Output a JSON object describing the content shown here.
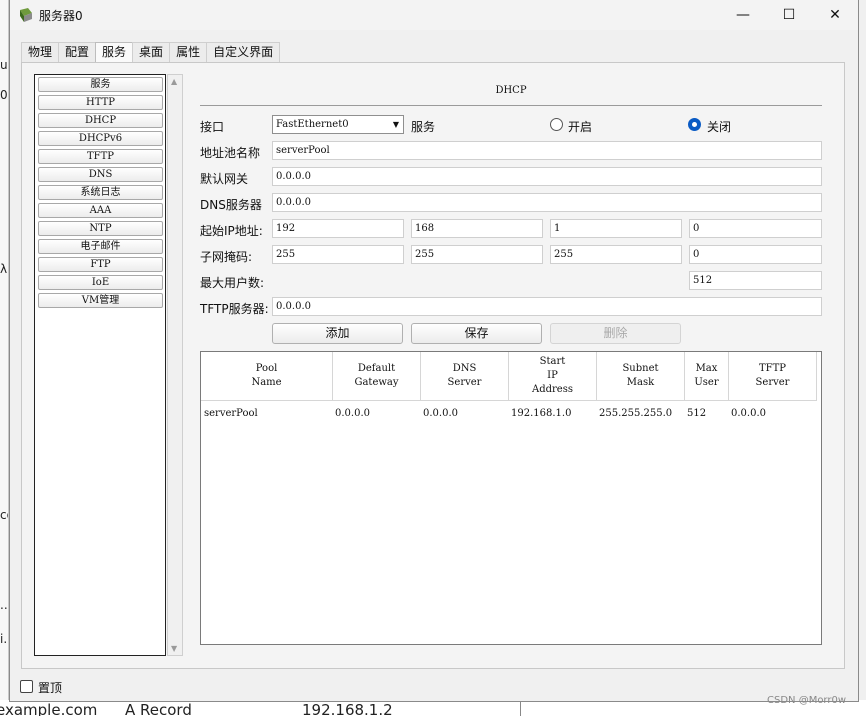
{
  "background": {
    "left_fragments": [
      "ul",
      "0",
      "λ",
      "co",
      "..",
      "i."
    ],
    "bottom_texts": [
      "example.com",
      "A Record",
      "192.168.1.2"
    ]
  },
  "window": {
    "title": "服务器0",
    "controls": {
      "minimize": "—",
      "maximize": "☐",
      "close": "✕"
    }
  },
  "tabs": [
    {
      "label": "物理",
      "active": false
    },
    {
      "label": "配置",
      "active": false
    },
    {
      "label": "服务",
      "active": true
    },
    {
      "label": "桌面",
      "active": false
    },
    {
      "label": "属性",
      "active": false
    },
    {
      "label": "自定义界面",
      "active": false
    }
  ],
  "services": [
    "服务",
    "HTTP",
    "DHCP",
    "DHCPv6",
    "TFTP",
    "DNS",
    "系统日志",
    "AAA",
    "NTP",
    "电子邮件",
    "FTP",
    "IoE",
    "VM管理"
  ],
  "dhcp": {
    "section_title": "DHCP",
    "interface_label": "接口",
    "interface_value": "FastEthernet0",
    "service_label": "服务",
    "on_label": "开启",
    "off_label": "关闭",
    "service_state": "关闭",
    "pool_name_label": "地址池名称",
    "pool_name_value": "serverPool",
    "gateway_label": "默认网关",
    "gateway_value": "0.0.0.0",
    "dns_label": "DNS服务器",
    "dns_value": "0.0.0.0",
    "start_ip_label": "起始IP地址:",
    "start_ip": [
      "192",
      "168",
      "1",
      "0"
    ],
    "mask_label": "子网掩码:",
    "mask": [
      "255",
      "255",
      "255",
      "0"
    ],
    "max_users_label": "最大用户数:",
    "max_users_value": "512",
    "tftp_label": "TFTP服务器:",
    "tftp_value": "0.0.0.0",
    "add_button": "添加",
    "save_button": "保存",
    "delete_button": "删除"
  },
  "table": {
    "headers": [
      "Pool\nName",
      "Default\nGateway",
      "DNS\nServer",
      "Start\nIP\nAddress",
      "Subnet\nMask",
      "Max\nUser",
      "TFTP\nServer"
    ],
    "rows": [
      [
        "serverPool",
        "0.0.0.0",
        "0.0.0.0",
        "192.168.1.0",
        "255.255.255.0",
        "512",
        "0.0.0.0"
      ]
    ]
  },
  "footer": {
    "top_label": "置顶",
    "top_checked": false
  },
  "watermark": "CSDN @Morr0w",
  "colors": {
    "accent": "#0a5bc4",
    "tab_active": "#fafafa",
    "window_bg": "#f0f0f0"
  }
}
